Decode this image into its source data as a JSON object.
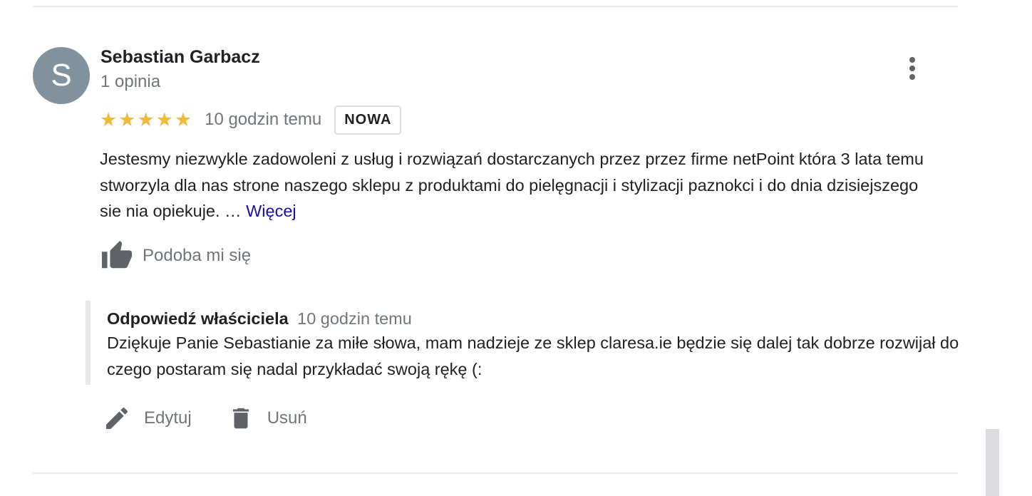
{
  "review": {
    "avatar_letter": "S",
    "reviewer_name": "Sebastian Garbacz",
    "review_count": "1 opinia",
    "rating": 5,
    "rating_max": 5,
    "star_color": "#f2b93b",
    "time": "10 godzin temu",
    "badge": "NOWA",
    "text": "Jestesmy niezwykle zadowoleni z usług i rozwiązań dostarczanych przez przez firme netPoint która 3 lata temu stworzyla dla nas strone naszego sklepu z produktami do pielęgnacji i stylizacji paznokci i do dnia dzisiejszego sie nia opiekuje. … ",
    "more_link": "Więcej",
    "like_label": "Podoba mi się"
  },
  "owner_reply": {
    "title": "Odpowiedź właściciela",
    "time": "10 godzin temu",
    "text": "Dziękuje Panie Sebastianie za miłe słowa, mam nadzieje ze sklep claresa.ie będzie się dalej tak dobrze rozwijał do czego postaram się nadal przykładać swoją rękę (:"
  },
  "actions": {
    "edit_label": "Edytuj",
    "delete_label": "Usuń"
  },
  "icons": {
    "menu": "more-vert-icon",
    "like": "thumb-up-icon",
    "edit": "pencil-icon",
    "delete": "trash-icon"
  },
  "colors": {
    "avatar_bg": "#7f929e",
    "link": "#1a0dab",
    "muted_text": "#70757a"
  }
}
